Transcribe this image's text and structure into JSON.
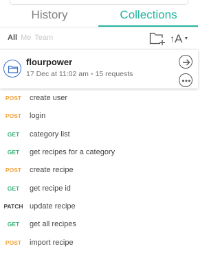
{
  "tabs": {
    "history": "History",
    "collections": "Collections"
  },
  "filters": {
    "all": "All",
    "me": "Me",
    "team": "Team"
  },
  "sort": {
    "letter": "A"
  },
  "collection": {
    "name": "flourpower",
    "date": "17 Dec at 11:02 am",
    "separator": "•",
    "count": "15 requests"
  },
  "requests": [
    {
      "method": "POST",
      "name": "create user"
    },
    {
      "method": "POST",
      "name": "login"
    },
    {
      "method": "GET",
      "name": "category list"
    },
    {
      "method": "GET",
      "name": "get recipes for a category"
    },
    {
      "method": "POST",
      "name": "create recipe"
    },
    {
      "method": "GET",
      "name": "get recipe id"
    },
    {
      "method": "PATCH",
      "name": "update recipe"
    },
    {
      "method": "GET",
      "name": "get all recipes"
    },
    {
      "method": "POST",
      "name": "import recipe"
    }
  ],
  "colors": {
    "accent": "#26b5a0",
    "post": "#f0a23a",
    "get": "#3cb37a",
    "patch": "#444444",
    "folder": "#3a6fc6"
  }
}
